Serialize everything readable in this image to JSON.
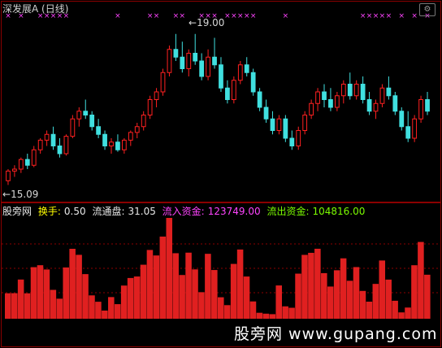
{
  "upper": {
    "title": "深发展A (日线)",
    "high_label": "19.00",
    "low_label": "15.09",
    "y_range": [
      14.7,
      19.5
    ]
  },
  "lower": {
    "name": "股旁网",
    "turnover_label": "换手:",
    "turnover_value": "0.50",
    "float_label": "流通盘:",
    "float_value": "31.05",
    "inflow_label": "流入资金:",
    "inflow_value": "123749.00",
    "outflow_label": "流出资金:",
    "outflow_value": "104816.00"
  },
  "watermark": "股旁网 www.gupang.com",
  "colors": {
    "up": "#ff2020",
    "down": "#40e0e0",
    "grid": "#8b0000",
    "marker": "#ff44ff",
    "flow_pos": "#e02020",
    "flow_neg": "#30d030"
  },
  "chart_data": {
    "type": "candlestick",
    "series": [
      {
        "values_ohlc": [
          [
            15.2,
            15.5,
            15.09,
            15.45
          ],
          [
            15.45,
            15.6,
            15.3,
            15.5
          ],
          [
            15.5,
            15.8,
            15.4,
            15.75
          ],
          [
            15.75,
            15.9,
            15.5,
            15.6
          ],
          [
            15.6,
            16.1,
            15.55,
            16.0
          ],
          [
            16.0,
            16.3,
            15.9,
            16.25
          ],
          [
            16.25,
            16.5,
            16.1,
            16.4
          ],
          [
            16.4,
            16.6,
            16.0,
            16.1
          ],
          [
            16.1,
            16.3,
            15.8,
            15.9
          ],
          [
            15.9,
            16.4,
            15.85,
            16.35
          ],
          [
            16.35,
            16.9,
            16.3,
            16.8
          ],
          [
            16.8,
            17.1,
            16.6,
            17.0
          ],
          [
            17.0,
            17.3,
            16.8,
            16.9
          ],
          [
            16.9,
            17.0,
            16.5,
            16.6
          ],
          [
            16.6,
            16.8,
            16.3,
            16.4
          ],
          [
            16.4,
            16.5,
            16.0,
            16.1
          ],
          [
            16.1,
            16.3,
            15.9,
            16.2
          ],
          [
            16.2,
            16.4,
            15.95,
            16.0
          ],
          [
            16.0,
            16.3,
            15.9,
            16.25
          ],
          [
            16.25,
            16.5,
            16.1,
            16.45
          ],
          [
            16.45,
            16.7,
            16.3,
            16.6
          ],
          [
            16.6,
            17.0,
            16.5,
            16.9
          ],
          [
            16.9,
            17.4,
            16.8,
            17.3
          ],
          [
            17.3,
            17.6,
            17.1,
            17.5
          ],
          [
            17.5,
            18.1,
            17.4,
            18.0
          ],
          [
            18.0,
            18.7,
            17.9,
            18.6
          ],
          [
            18.6,
            19.0,
            18.3,
            18.4
          ],
          [
            18.4,
            18.8,
            18.0,
            18.1
          ],
          [
            18.1,
            18.6,
            17.9,
            18.5
          ],
          [
            18.5,
            19.0,
            18.2,
            18.3
          ],
          [
            18.3,
            18.5,
            17.8,
            17.9
          ],
          [
            17.9,
            18.6,
            17.8,
            18.4
          ],
          [
            18.4,
            18.9,
            18.1,
            18.2
          ],
          [
            18.2,
            18.4,
            17.5,
            17.6
          ],
          [
            17.6,
            17.8,
            17.2,
            17.3
          ],
          [
            17.3,
            17.9,
            17.2,
            17.8
          ],
          [
            17.8,
            18.3,
            17.7,
            18.2
          ],
          [
            18.2,
            18.4,
            17.9,
            18.0
          ],
          [
            18.0,
            18.1,
            17.4,
            17.5
          ],
          [
            17.5,
            17.6,
            17.0,
            17.1
          ],
          [
            17.1,
            17.3,
            16.7,
            16.8
          ],
          [
            16.8,
            17.0,
            16.4,
            16.5
          ],
          [
            16.5,
            16.9,
            16.4,
            16.8
          ],
          [
            16.8,
            16.9,
            16.2,
            16.3
          ],
          [
            16.3,
            16.5,
            16.0,
            16.1
          ],
          [
            16.1,
            16.6,
            16.0,
            16.5
          ],
          [
            16.5,
            17.0,
            16.4,
            16.9
          ],
          [
            16.9,
            17.3,
            16.8,
            17.2
          ],
          [
            17.2,
            17.6,
            17.0,
            17.5
          ],
          [
            17.5,
            17.7,
            17.1,
            17.3
          ],
          [
            17.3,
            17.6,
            17.0,
            17.1
          ],
          [
            17.1,
            17.5,
            17.0,
            17.4
          ],
          [
            17.4,
            17.8,
            17.2,
            17.7
          ],
          [
            17.7,
            18.0,
            17.3,
            17.4
          ],
          [
            17.4,
            17.8,
            17.3,
            17.7
          ],
          [
            17.7,
            17.9,
            17.2,
            17.3
          ],
          [
            17.3,
            17.5,
            16.9,
            17.0
          ],
          [
            17.0,
            17.3,
            16.8,
            17.2
          ],
          [
            17.2,
            17.7,
            17.1,
            17.6
          ],
          [
            17.6,
            17.9,
            17.3,
            17.4
          ],
          [
            17.4,
            17.5,
            16.9,
            17.0
          ],
          [
            17.0,
            17.1,
            16.5,
            16.6
          ],
          [
            16.6,
            17.0,
            16.2,
            16.3
          ],
          [
            16.3,
            16.9,
            16.2,
            16.8
          ],
          [
            16.8,
            17.4,
            16.7,
            17.3
          ],
          [
            17.3,
            17.5,
            16.9,
            17.0
          ]
        ]
      }
    ],
    "ylim": [
      14.7,
      19.5
    ]
  }
}
